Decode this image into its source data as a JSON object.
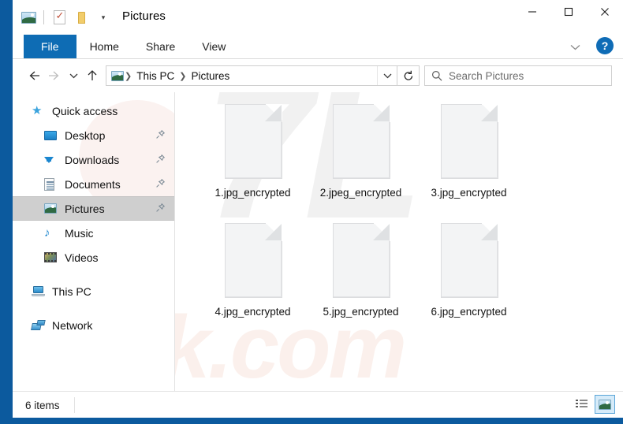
{
  "window": {
    "title": "Pictures",
    "folder_icon": "pictures-folder-icon",
    "quick_access_toolbar": [
      {
        "name": "properties-icon",
        "label": "Properties"
      },
      {
        "name": "new-folder-icon",
        "label": "New folder"
      },
      {
        "name": "customize-qat-caret",
        "label": "▾"
      }
    ],
    "controls": {
      "minimize": "Minimize",
      "maximize": "Maximize",
      "close": "Close",
      "ribbon_toggle": "Minimize the Ribbon",
      "help": "?"
    }
  },
  "ribbon": {
    "tabs": [
      {
        "label": "File",
        "active": true
      },
      {
        "label": "Home",
        "active": false
      },
      {
        "label": "Share",
        "active": false
      },
      {
        "label": "View",
        "active": false
      }
    ]
  },
  "navigation": {
    "back": "Back",
    "forward": "Forward",
    "recent": "Recent locations",
    "up": "Up",
    "breadcrumb": {
      "icon": "pictures-folder-icon",
      "items": [
        "This PC",
        "Pictures"
      ],
      "separator": "❯"
    },
    "address_dropdown": "▾",
    "refresh": "Refresh",
    "search": {
      "placeholder": "Search Pictures",
      "value": "",
      "icon": "search-icon"
    }
  },
  "sidebar": {
    "items": [
      {
        "label": "Quick access",
        "icon": "star-icon",
        "type": "group",
        "pinned": false,
        "selected": false
      },
      {
        "label": "Desktop",
        "icon": "desktop-icon",
        "type": "child",
        "pinned": true,
        "selected": false
      },
      {
        "label": "Downloads",
        "icon": "download-icon",
        "type": "child",
        "pinned": true,
        "selected": false
      },
      {
        "label": "Documents",
        "icon": "document-icon",
        "type": "child",
        "pinned": true,
        "selected": false
      },
      {
        "label": "Pictures",
        "icon": "pictures-icon",
        "type": "child",
        "pinned": true,
        "selected": true
      },
      {
        "label": "Music",
        "icon": "music-icon",
        "type": "child",
        "pinned": false,
        "selected": false
      },
      {
        "label": "Videos",
        "icon": "video-icon",
        "type": "child",
        "pinned": false,
        "selected": false
      },
      {
        "label": "This PC",
        "icon": "thispc-icon",
        "type": "group",
        "pinned": false,
        "selected": false
      },
      {
        "label": "Network",
        "icon": "network-icon",
        "type": "group",
        "pinned": false,
        "selected": false
      }
    ],
    "pin_icon": "pin-icon"
  },
  "files": [
    {
      "name": "1.jpg_encrypted",
      "icon": "blank-file-icon"
    },
    {
      "name": "2.jpeg_encrypted",
      "icon": "blank-file-icon"
    },
    {
      "name": "3.jpg_encrypted",
      "icon": "blank-file-icon"
    },
    {
      "name": "4.jpg_encrypted",
      "icon": "blank-file-icon"
    },
    {
      "name": "5.jpg_encrypted",
      "icon": "blank-file-icon"
    },
    {
      "name": "6.jpg_encrypted",
      "icon": "blank-file-icon"
    }
  ],
  "watermark": {
    "logo": "PC",
    "text": "isk.com"
  },
  "status": {
    "item_count": "6 items",
    "views": [
      {
        "name": "details-view-button",
        "active": false
      },
      {
        "name": "large-icons-view-button",
        "active": true
      }
    ]
  },
  "colors": {
    "window_frame": "#0c5a9e",
    "file_tab": "#0e6cb4",
    "selection": "#cfcfcf",
    "help_button": "#0f6cb6"
  }
}
